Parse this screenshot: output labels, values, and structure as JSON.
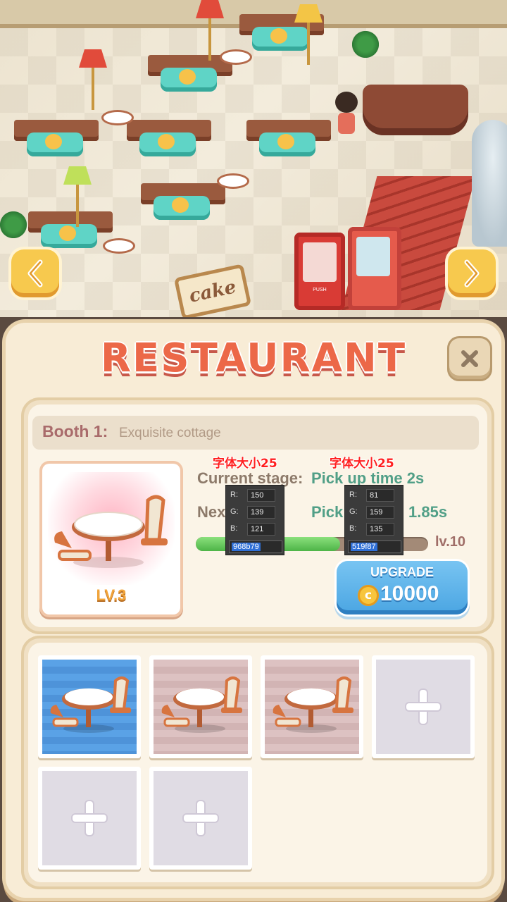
{
  "scene": {
    "sign_text": "cake",
    "vending_label": "PUSH"
  },
  "panel": {
    "title": "RESTAURANT",
    "close_icon": "close-icon"
  },
  "booth": {
    "number_label": "Booth 1:",
    "name": "Exquisite cottage",
    "level": "LV.3",
    "current_label": "Current stage:",
    "current_value": "Pick up time 2s",
    "next_label": "Nex",
    "next_value": "Pick",
    "next_value_extra": "1.85s",
    "progress": 0.62,
    "max_level": "lv.10"
  },
  "upgrade": {
    "label": "UPGRADE",
    "cost": "10000",
    "coin_icon": "coin-icon",
    "coin_symbol": "c"
  },
  "annotations": [
    {
      "note": "字体大小25",
      "r": "150",
      "g": "139",
      "b": "121",
      "hex": "968b79"
    },
    {
      "note": "字体大小25",
      "r": "81",
      "g": "159",
      "b": "135",
      "hex": "519f87"
    }
  ],
  "slots": [
    {
      "state": "selected"
    },
    {
      "state": "owned"
    },
    {
      "state": "owned"
    },
    {
      "state": "empty"
    },
    {
      "state": "empty"
    },
    {
      "state": "empty"
    }
  ],
  "colors": {
    "title": "#ec6848",
    "label_gray": "#968b79",
    "value_green": "#519f87",
    "upgrade_blue": "#4aa5e2"
  }
}
